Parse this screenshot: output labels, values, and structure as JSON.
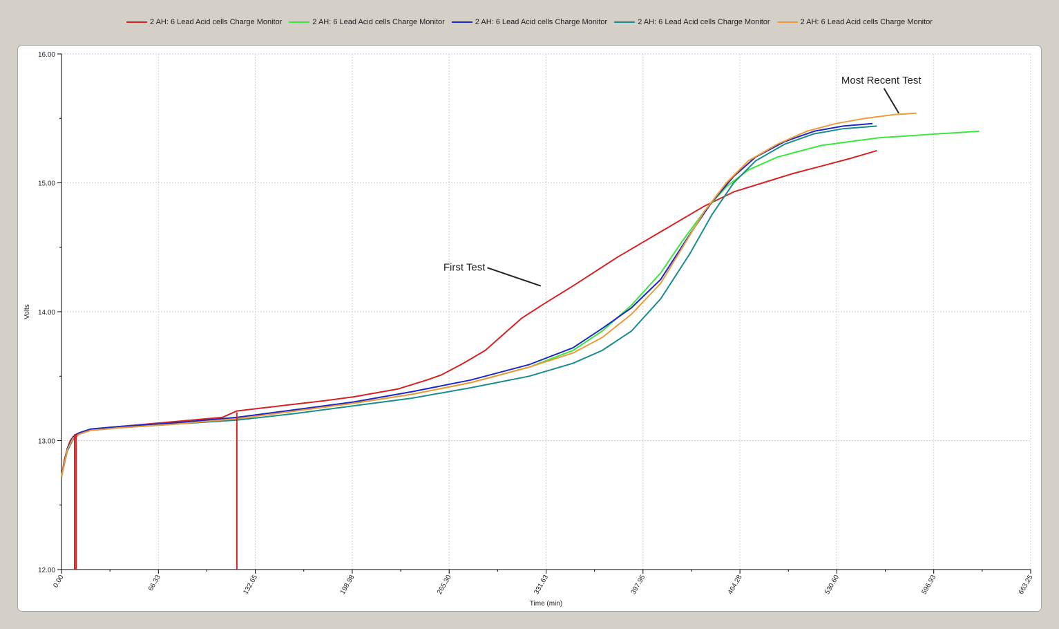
{
  "colors": {
    "red": "#d62121",
    "green": "#39e83d",
    "blue": "#1d26c9",
    "teal": "#1a8c8f",
    "orange": "#ef9a3a",
    "grid": "#d0d0d0",
    "axis": "#000000"
  },
  "chart_data": {
    "type": "line",
    "xlabel": "Time (min)",
    "ylabel": "Volts",
    "xlim": [
      0,
      663.25
    ],
    "ylim": [
      12.0,
      16.0
    ],
    "x_ticks": [
      "0.00",
      "66.33",
      "132.65",
      "198.98",
      "265.30",
      "331.63",
      "397.95",
      "464.28",
      "530.60",
      "596.93",
      "663.25"
    ],
    "y_ticks": [
      "12.00",
      "13.00",
      "14.00",
      "15.00",
      "16.00"
    ],
    "grid": true,
    "legend_position": "top",
    "series": [
      {
        "name": "2 AH: 6 Lead Acid cells Charge Monitor",
        "color": "#d62121",
        "x": [
          0,
          2,
          4,
          6,
          8,
          10,
          12,
          15,
          20,
          30,
          50,
          80,
          110,
          120,
          150,
          180,
          200,
          230,
          250,
          260,
          275,
          290,
          300,
          315,
          330,
          350,
          380,
          410,
          440,
          460,
          480,
          500,
          520,
          540,
          558
        ],
        "y": [
          12.72,
          12.85,
          12.94,
          13.0,
          13.03,
          13.05,
          13.06,
          13.07,
          13.09,
          13.1,
          13.12,
          13.15,
          13.18,
          13.23,
          13.27,
          13.31,
          13.34,
          13.4,
          13.47,
          13.51,
          13.6,
          13.7,
          13.8,
          13.95,
          14.06,
          14.2,
          14.42,
          14.62,
          14.82,
          14.93,
          15.0,
          15.07,
          15.13,
          15.19,
          15.25
        ]
      },
      {
        "name": "2 AH: 6 Lead Acid cells Charge Monitor",
        "color": "#39e83d",
        "x": [
          0,
          4,
          8,
          12,
          20,
          40,
          80,
          120,
          160,
          200,
          240,
          280,
          320,
          350,
          370,
          390,
          410,
          425,
          440,
          455,
          470,
          490,
          520,
          560,
          600,
          628
        ],
        "y": [
          12.72,
          12.94,
          13.03,
          13.06,
          13.09,
          13.11,
          13.14,
          13.18,
          13.24,
          13.29,
          13.36,
          13.45,
          13.57,
          13.7,
          13.85,
          14.05,
          14.3,
          14.55,
          14.78,
          14.97,
          15.1,
          15.2,
          15.29,
          15.35,
          15.38,
          15.4
        ]
      },
      {
        "name": "2 AH: 6 Lead Acid cells Charge Monitor",
        "color": "#1d26c9",
        "x": [
          0,
          4,
          8,
          12,
          20,
          40,
          80,
          120,
          160,
          200,
          240,
          280,
          320,
          350,
          370,
          390,
          410,
          430,
          445,
          460,
          475,
          495,
          515,
          535,
          555
        ],
        "y": [
          12.72,
          12.94,
          13.03,
          13.06,
          13.09,
          13.11,
          13.14,
          13.18,
          13.24,
          13.3,
          13.38,
          13.47,
          13.59,
          13.72,
          13.87,
          14.03,
          14.25,
          14.6,
          14.85,
          15.05,
          15.2,
          15.32,
          15.4,
          15.44,
          15.46
        ]
      },
      {
        "name": "2 AH: 6 Lead Acid cells Charge Monitor",
        "color": "#1a8c8f",
        "x": [
          0,
          4,
          8,
          12,
          20,
          40,
          80,
          120,
          160,
          200,
          240,
          280,
          320,
          350,
          370,
          390,
          410,
          430,
          445,
          460,
          475,
          495,
          515,
          535,
          558
        ],
        "y": [
          12.72,
          12.92,
          13.01,
          13.05,
          13.08,
          13.1,
          13.13,
          13.16,
          13.21,
          13.27,
          13.33,
          13.41,
          13.5,
          13.6,
          13.7,
          13.85,
          14.1,
          14.45,
          14.75,
          15.0,
          15.17,
          15.3,
          15.38,
          15.42,
          15.44
        ]
      },
      {
        "name": "2 AH: 6 Lead Acid cells Charge Monitor",
        "color": "#ef9a3a",
        "x": [
          0,
          4,
          8,
          12,
          20,
          40,
          80,
          120,
          160,
          200,
          240,
          280,
          320,
          350,
          370,
          390,
          410,
          425,
          440,
          455,
          470,
          490,
          510,
          530,
          550,
          570,
          585
        ],
        "y": [
          12.72,
          12.93,
          13.02,
          13.05,
          13.08,
          13.1,
          13.13,
          13.17,
          13.23,
          13.29,
          13.36,
          13.45,
          13.57,
          13.68,
          13.8,
          13.98,
          14.22,
          14.5,
          14.78,
          15.0,
          15.17,
          15.3,
          15.4,
          15.46,
          15.5,
          15.53,
          15.54
        ]
      }
    ],
    "spikes": [
      {
        "series": 0,
        "x": 9,
        "y_from": 12.0,
        "y_to": 13.05
      },
      {
        "series": 0,
        "x": 10,
        "y_from": 12.0,
        "y_to": 13.05
      },
      {
        "series": 0,
        "x": 120,
        "y_from": 12.0,
        "y_to": 13.22
      }
    ],
    "annotations": [
      {
        "text": "First Test",
        "x": 290,
        "y": 14.32,
        "target_x": 328,
        "target_y": 14.2
      },
      {
        "text": "Most Recent Test",
        "x": 561,
        "y": 15.77,
        "target_x": 573,
        "target_y": 15.54
      }
    ]
  }
}
